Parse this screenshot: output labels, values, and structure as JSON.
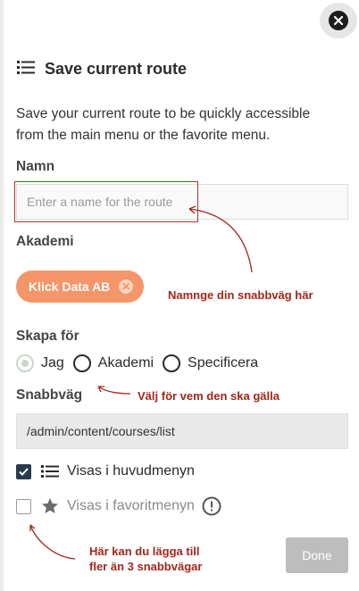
{
  "dialog": {
    "title": "Save current route",
    "description": "Save your current route to be quickly accessible from the main menu or the favorite menu."
  },
  "name_field": {
    "label": "Namn",
    "placeholder": "Enter a name for the route",
    "value": ""
  },
  "academy": {
    "label": "Akademi",
    "chip_label": "Klick Data AB"
  },
  "create_for": {
    "label": "Skapa för",
    "options": [
      {
        "label": "Jag",
        "selected": true
      },
      {
        "label": "Akademi",
        "selected": false
      },
      {
        "label": "Specificera",
        "selected": false
      }
    ]
  },
  "shortcut": {
    "label": "Snabbväg",
    "path": "/admin/content/courses/list"
  },
  "menus": {
    "main_menu_label": "Visas i huvudmenyn",
    "main_menu_checked": true,
    "favorite_menu_label": "Visas i favoritmenyn",
    "favorite_menu_checked": false
  },
  "done_button": {
    "label": "Done"
  },
  "annotations": {
    "name_hint": "Namnge din snabbväg här",
    "who_hint": "Välj för vem den ska gälla",
    "favorite_hint_line1": "Här kan du lägga till",
    "favorite_hint_line2": "fler än 3 snabbvägar"
  },
  "colors": {
    "chip": "#f4956a",
    "annotation": "#a3261a",
    "checked": "#2b3b4e",
    "done_disabled": "#bdbdbd"
  }
}
